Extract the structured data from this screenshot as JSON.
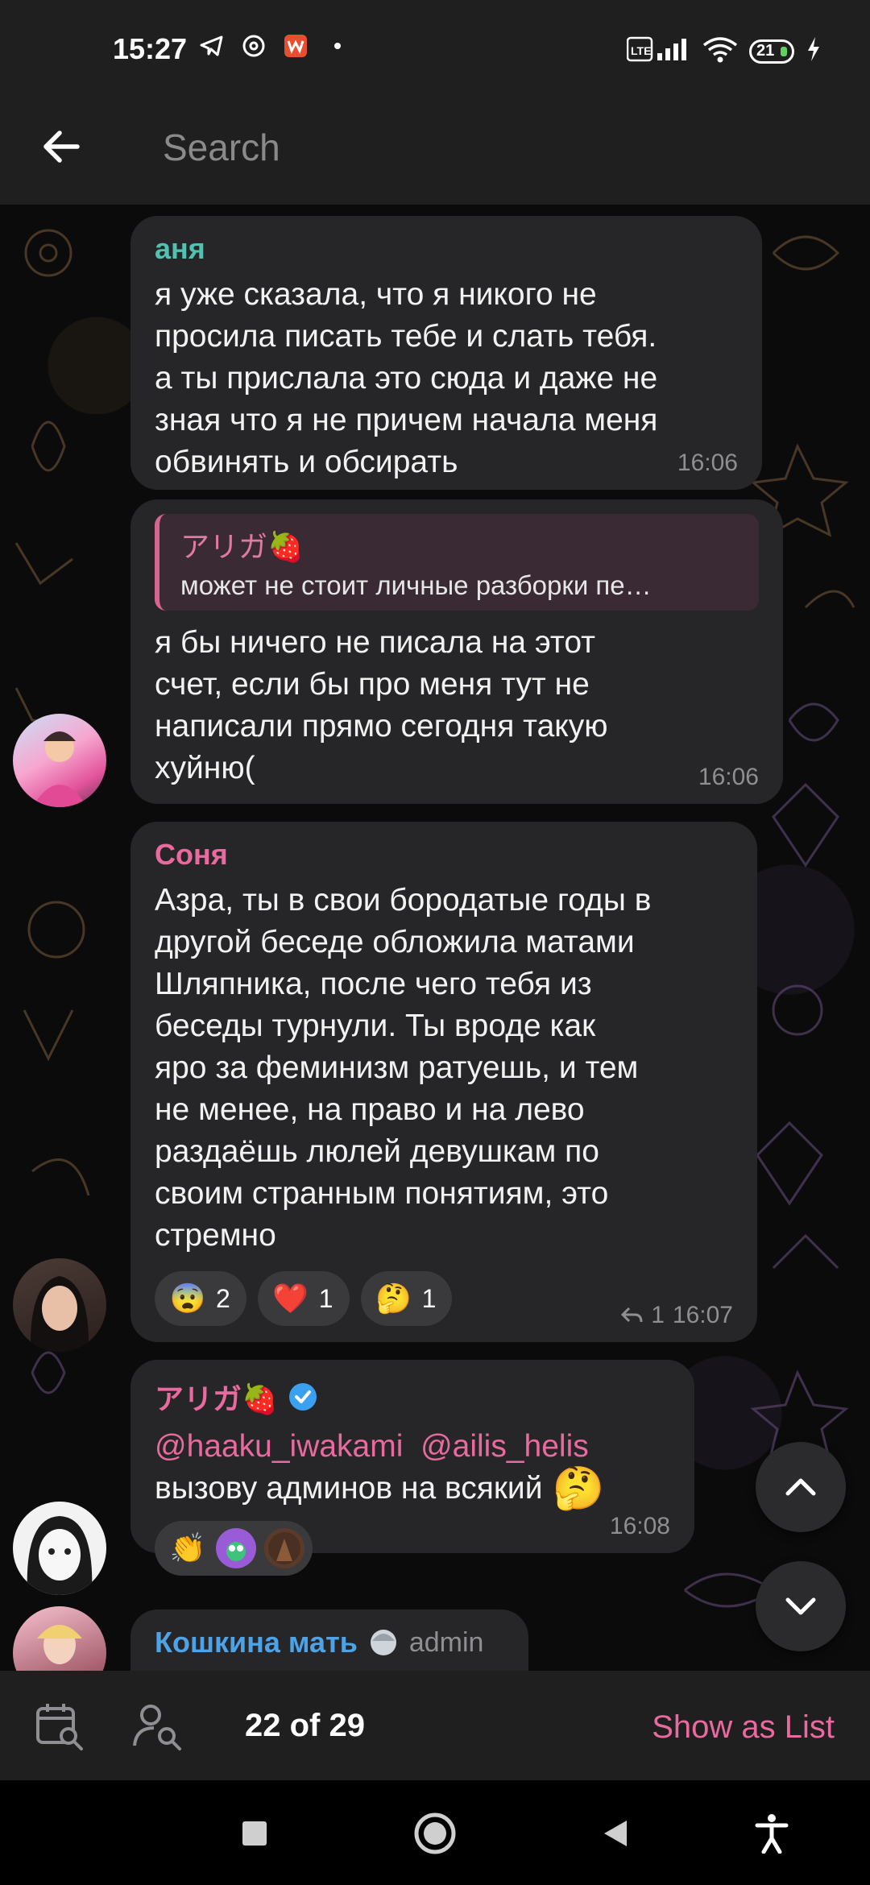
{
  "status_bar": {
    "time": "15:27",
    "battery": "21",
    "network": "VoLTE"
  },
  "top_bar": {
    "search_placeholder": "Search"
  },
  "messages": [
    {
      "sender": "аня",
      "sender_color": "#4fc3b0",
      "text": "я уже сказала, что я никого не\nпросила писать тебе и слать тебя.\nа ты прислала это сюда и даже не\nзная что я не причем начала меня\nобвинять и обсирать",
      "time": "16:06"
    },
    {
      "reply_name": "アリガ🍓",
      "reply_text": "может не стоит личные разборки пе…",
      "text": "я бы ничего не писала на этот\nсчет, если бы про меня тут не\nнаписали прямо сегодня такую\nхуйню(",
      "time": "16:06"
    },
    {
      "sender": "Соня",
      "sender_color": "#e86a9e",
      "text": "Азра, ты в свои бородатые годы в\nдругой беседе обложила матами\nШляпника, после чего тебя из\nбеседы турнули. Ты вроде как\nяро за феминизм ратуешь, и тем\nне менее, на право и на лево\nраздаёшь люлей девушкам по\nсвоим странным понятиям, это\nстремно",
      "reactions": [
        {
          "emoji": "😨",
          "count": "2"
        },
        {
          "emoji": "❤️",
          "count": "1"
        },
        {
          "emoji": "🤔",
          "count": "1"
        }
      ],
      "replies": "1",
      "time": "16:07"
    },
    {
      "sender": "アリガ🍓",
      "sender_color": "#e86a9e",
      "verified": true,
      "mentions": "@haaku_iwakami  @ailis_helis",
      "text": "вызову админов на всякий",
      "trailing_emoji": "🤔",
      "reaction_emoji": "👏",
      "time": "16:08"
    },
    {
      "sender": "Кошкина мать",
      "sender_color": "#4ea3e6",
      "role": "admin"
    }
  ],
  "search_nav": {
    "counter": "22 of 29",
    "show_as_list": "Show as List"
  },
  "icons": {
    "back": "arrow-left-icon",
    "calendar": "calendar-search-icon",
    "user": "user-search-icon",
    "up": "chevron-up-icon",
    "down": "chevron-down-icon"
  }
}
